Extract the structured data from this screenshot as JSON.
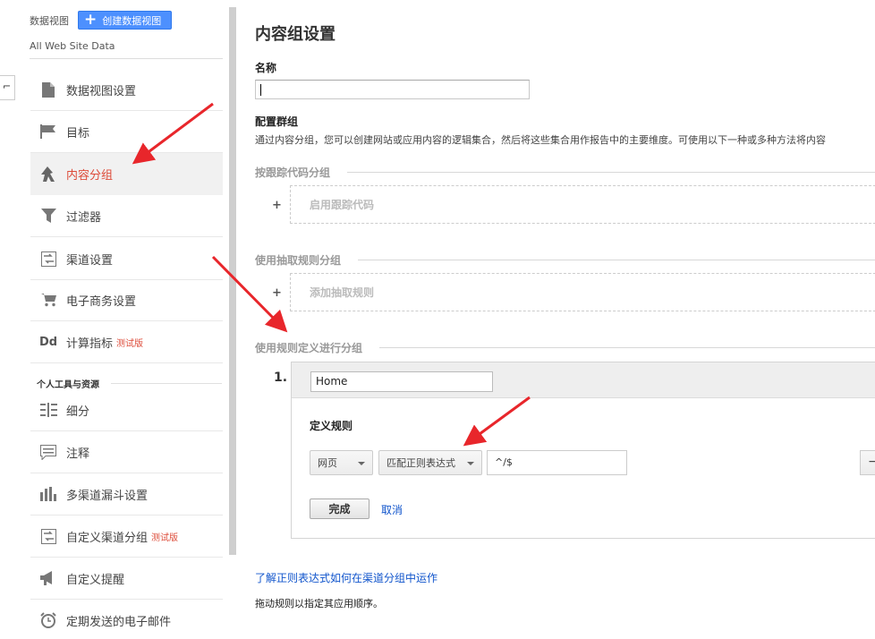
{
  "sidebar": {
    "view_label": "数据视图",
    "create_view_button": "创建数据视图",
    "view_name": "All Web Site Data",
    "items": [
      {
        "label": "数据视图设置",
        "icon": "document-icon",
        "active": false
      },
      {
        "label": "目标",
        "icon": "flag-icon",
        "active": false
      },
      {
        "label": "内容分组",
        "icon": "content-grouping-icon",
        "active": true
      },
      {
        "label": "过滤器",
        "icon": "filter-icon",
        "active": false
      },
      {
        "label": "渠道设置",
        "icon": "channel-settings-icon",
        "active": false
      },
      {
        "label": "电子商务设置",
        "icon": "cart-icon",
        "active": false
      },
      {
        "label": "计算指标",
        "icon": "dd-icon",
        "icon_text": "Dd",
        "beta": "测试版",
        "active": false
      }
    ],
    "section_title": "个人工具与资源",
    "tool_items": [
      {
        "label": "细分",
        "icon": "segments-icon"
      },
      {
        "label": "注释",
        "icon": "annotation-icon"
      },
      {
        "label": "多渠道漏斗设置",
        "icon": "bar-chart-icon"
      },
      {
        "label": "自定义渠道分组",
        "icon": "custom-channel-icon",
        "beta": "测试版"
      },
      {
        "label": "自定义提醒",
        "icon": "megaphone-icon"
      },
      {
        "label": "定期发送的电子邮件",
        "icon": "alarm-clock-icon"
      }
    ]
  },
  "main": {
    "title": "内容组设置",
    "name_label": "名称",
    "name_value": "",
    "groups_label": "配置群组",
    "groups_desc": "通过内容分组，您可以创建网站或应用内容的逻辑集合，然后将这些集合用作报告中的主要维度。可使用以下一种或多种方法将内容",
    "tracking_section": "按跟踪代码分组",
    "tracking_action": "启用跟踪代码",
    "extract_section": "使用抽取规则分组",
    "extract_action": "添加抽取规则",
    "rule_section": "使用规则定义进行分组",
    "rule": {
      "number": "1.",
      "group_name": "Home",
      "define_label": "定义规则",
      "dimension": "网页",
      "match_type": "匹配正则表达式",
      "expression": "^/$",
      "remove_label": "−",
      "done_label": "完成",
      "cancel_label": "取消"
    },
    "help_link": "了解正则表达式如何在渠道分组中运作",
    "drag_note": "拖动规则以指定其应用顺序。",
    "plus": "+"
  },
  "colors": {
    "accent_blue": "#4d90fe",
    "active_red": "#dd4b39",
    "link_blue": "#1155cc",
    "annotation_red": "#e8262b"
  }
}
